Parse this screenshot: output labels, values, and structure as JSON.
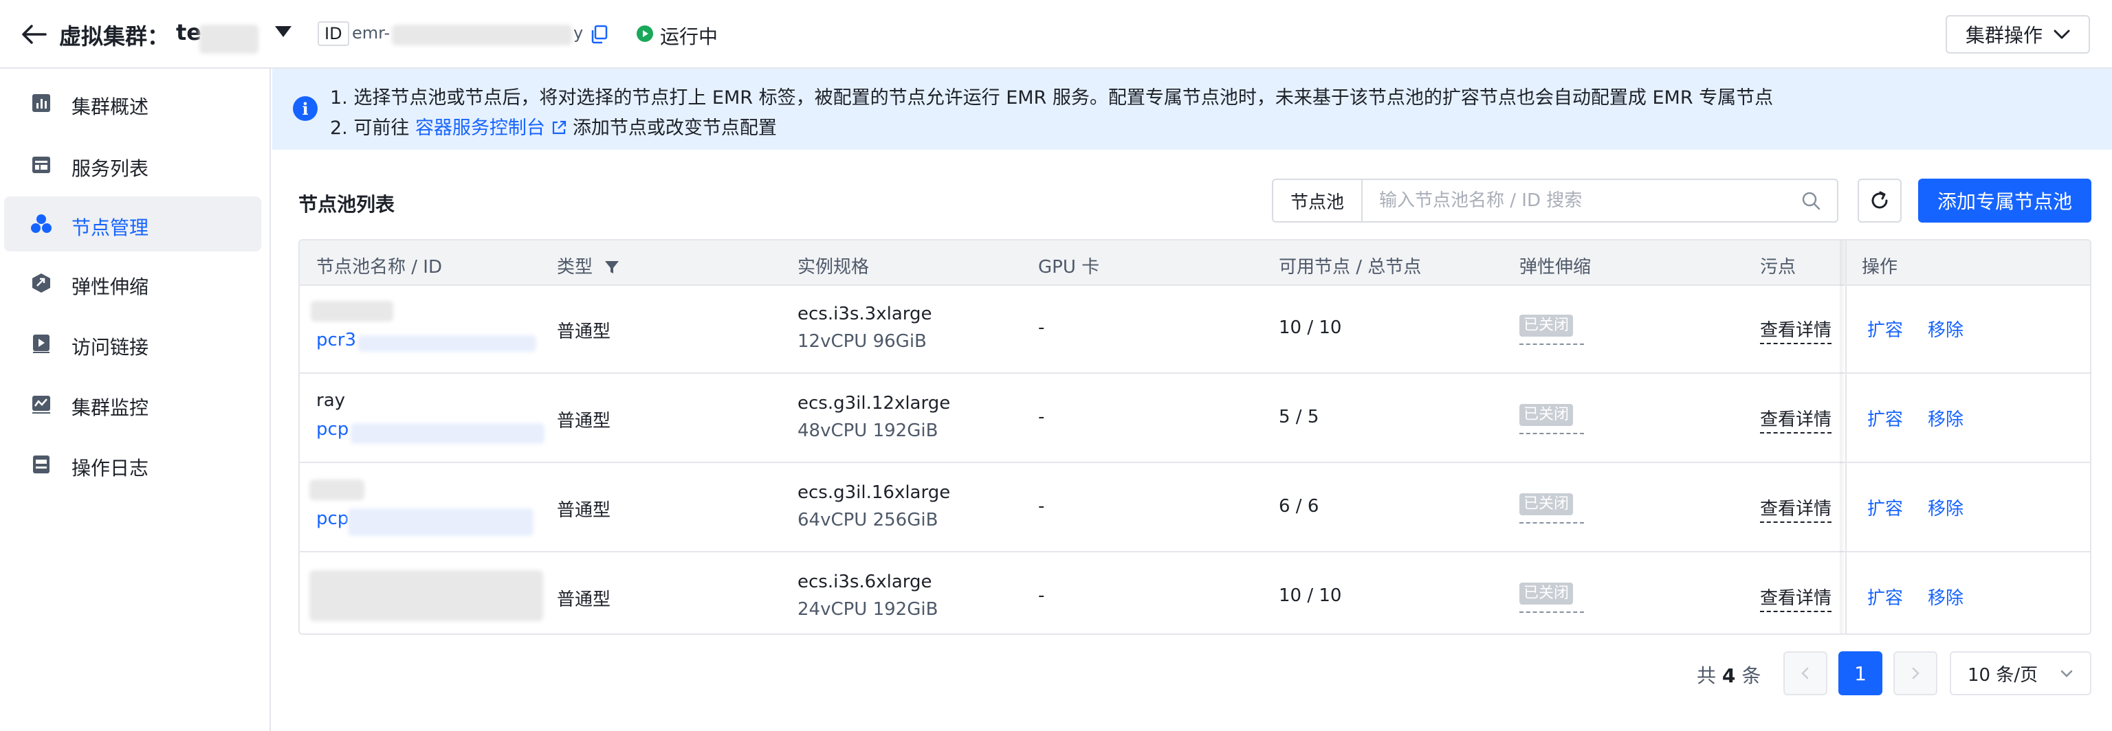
{
  "header": {
    "cluster_label": "虚拟集群：",
    "cluster_name_prefix": "te",
    "id_tag": "ID",
    "id_value_prefix": "emr-",
    "id_value_suffix": "y",
    "status": "运行中",
    "cluster_ops": "集群操作"
  },
  "sidebar": {
    "items": [
      {
        "label": "集群概述",
        "icon": "bar-chart-icon"
      },
      {
        "label": "服务列表",
        "icon": "service-list-icon"
      },
      {
        "label": "节点管理",
        "icon": "node-cluster-icon"
      },
      {
        "label": "弹性伸缩",
        "icon": "scale-icon"
      },
      {
        "label": "访问链接",
        "icon": "access-link-icon"
      },
      {
        "label": "集群监控",
        "icon": "monitor-icon"
      },
      {
        "label": "操作日志",
        "icon": "log-icon"
      }
    ],
    "active_index": 2
  },
  "banner": {
    "line1": "1. 选择节点池或节点后，将对选择的节点打上 EMR 标签，被配置的节点允许运行 EMR 服务。配置专属节点池时，未来基于该节点池的扩容节点也会自动配置成 EMR 专属节点",
    "line2_prefix": "2. 可前往",
    "line2_link": "容器服务控制台",
    "line2_suffix": "添加节点或改变节点配置"
  },
  "toolbar": {
    "title": "节点池列表",
    "search_select": "节点池",
    "search_placeholder": "输入节点池名称 / ID 搜索",
    "add_button": "添加专属节点池"
  },
  "table": {
    "columns": [
      "节点池名称 / ID",
      "类型",
      "实例规格",
      "GPU 卡",
      "可用节点 / 总节点",
      "弹性伸缩",
      "污点",
      "操作"
    ],
    "rows": [
      {
        "name": "",
        "id": "pcr3",
        "type": "普通型",
        "spec": "ecs.i3s.3xlarge",
        "spec_sub": "12vCPU 96GiB",
        "gpu": "-",
        "nodes": "10 / 10",
        "scaling": "已关闭",
        "taint": "查看详情",
        "op1": "扩容",
        "op2": "移除"
      },
      {
        "name": "ray",
        "id": "pcp",
        "type": "普通型",
        "spec": "ecs.g3il.12xlarge",
        "spec_sub": "48vCPU 192GiB",
        "gpu": "-",
        "nodes": "5 / 5",
        "scaling": "已关闭",
        "taint": "查看详情",
        "op1": "扩容",
        "op2": "移除"
      },
      {
        "name": "",
        "id": "pcp",
        "type": "普通型",
        "spec": "ecs.g3il.16xlarge",
        "spec_sub": "64vCPU 256GiB",
        "gpu": "-",
        "nodes": "6 / 6",
        "scaling": "已关闭",
        "taint": "查看详情",
        "op1": "扩容",
        "op2": "移除"
      },
      {
        "name": "",
        "id": "",
        "type": "普通型",
        "spec": "ecs.i3s.6xlarge",
        "spec_sub": "24vCPU 192GiB",
        "gpu": "-",
        "nodes": "10 / 10",
        "scaling": "已关闭",
        "taint": "查看详情",
        "op1": "扩容",
        "op2": "移除"
      }
    ]
  },
  "pagination": {
    "total_prefix": "共",
    "total_count": "4",
    "total_suffix": "条",
    "current_page": "1",
    "page_size": "10 条/页"
  },
  "colors": {
    "accent": "#1664ff",
    "status_running": "#1aa85a",
    "banner_bg": "#e6f1ff",
    "badge_gray": "#c9cdd4"
  }
}
